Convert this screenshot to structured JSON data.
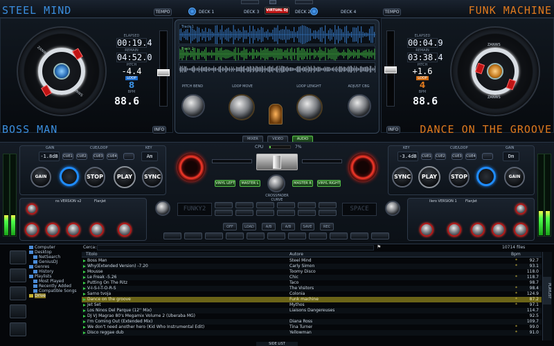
{
  "top": {
    "tempo_left": "TEMPO",
    "tempo_right": "TEMPO",
    "deck1": "DECK 1",
    "deck2": "DECK 2",
    "deck3": "DECK 3",
    "deck4": "DECK 4",
    "logo": "VIRTUAL DJ"
  },
  "left_deck": {
    "artist": "STEEL MIND",
    "title": "BOSS MAN",
    "elapsed_label": "ELAPSED",
    "elapsed": "00:19.4",
    "remain_label": "REMAIN",
    "remain": "04:52.0",
    "pitch_label": "PITCH",
    "pitch": "-4.4",
    "loop_label": "LOOP",
    "loop": "8",
    "bpm_label": "BPM",
    "bpm": "88.6",
    "info": "INFO",
    "brand": "ZANWS"
  },
  "right_deck": {
    "artist": "FUNK MACHINE",
    "title": "DANCE ON THE GROOVE",
    "elapsed_label": "ELAPSED",
    "elapsed": "00:04.9",
    "remain_label": "REMAIN",
    "remain": "03:38.4",
    "pitch_label": "PITCH",
    "pitch": "+1.6",
    "loop_label": "LOOP",
    "loop": "4",
    "bpm_label": "BPM",
    "bpm": "88.6",
    "info": "INFO",
    "brand": "ZANWS"
  },
  "center": {
    "track1_label": "Track 1",
    "track2_label": "Track 2",
    "knobs": [
      "PITCH BEND",
      "LOOP MOVE",
      "LOOP LENGHT",
      "ADJUST CBG"
    ],
    "tabs": [
      "MIXER",
      "VIDEO",
      "AUDIO"
    ]
  },
  "mixer": {
    "gain_label": "GAIN",
    "cue_label": "CUE/LOOP",
    "key_label": "KEY",
    "cpu_label": "CPU",
    "cpu_value": "7%",
    "left_gain": "-1.8dB",
    "right_gain": "-3.4dB",
    "left_key": "Am",
    "right_key": "Dm",
    "cues": [
      "CUE1",
      "CUE2",
      "CUE3",
      "CUE4"
    ],
    "stop": "STOP",
    "play": "PLAY",
    "sync": "SYNC",
    "gain_btn": "GAIN",
    "vinyl_left": "VINYL LEFT",
    "master_l": "MASTER L",
    "master_r": "MASTER R",
    "vinyl_right": "VINYL RIGHT",
    "crossfader": "CROSSFADER CURVE",
    "fx_left": "ns VERSION v2",
    "fx_left2": "FlanJet",
    "fx_right": "Ilero VERSION 1",
    "fx_right2": "FlanJet",
    "sampler_left": "FUNKY2",
    "sampler_right": "SPACE",
    "sampler_keys": [
      "OFF",
      "LOAD",
      "A/B",
      "A/B",
      "SAVE",
      "REC"
    ]
  },
  "browser": {
    "search_label": "Cerca:",
    "files_count": "10714 files",
    "col_title": "Titolo",
    "col_artist": "Autore",
    "col_bpm": "Bpm",
    "side_list": "SIDE LIST",
    "tree": [
      "Computer",
      "Desktop",
      "NetSearch",
      "GeniusDJ",
      "Genres",
      "History",
      "Playlists",
      "Most Played",
      "Recently Added",
      "Compatible Songs",
      "Drive"
    ],
    "tracks": [
      {
        "title": "Boss Man",
        "artist": "Steel Mind",
        "bpm": "92.7",
        "star": "*"
      },
      {
        "title": "Why(Extended Version) -7.20",
        "artist": "Carly Simon",
        "bpm": "93.1",
        "star": "*"
      },
      {
        "title": "Mousse",
        "artist": "Toomy Disco",
        "bpm": "118.0",
        "star": ""
      },
      {
        "title": "Le Freak -5.26",
        "artist": "Chic",
        "bpm": "118.7",
        "star": "*"
      },
      {
        "title": "Putting On The Ritz",
        "artist": "Taco",
        "bpm": "98.7",
        "star": ""
      },
      {
        "title": "V-I-S-I-T-O-R-S",
        "artist": "The Visitors",
        "bpm": "98.4",
        "star": "*"
      },
      {
        "title": "Sarno tvoja",
        "artist": "Colonia",
        "bpm": "124.9",
        "star": "*"
      },
      {
        "title": "Dance on the groove",
        "artist": "Funk machine",
        "bpm": "87.2",
        "star": "*"
      },
      {
        "title": "Jet Set",
        "artist": "Mythos",
        "bpm": "97.1",
        "star": "*"
      },
      {
        "title": "Los Ninos Del Parque (12'' Mix)",
        "artist": "Liaisons Dangereuses",
        "bpm": "114.7",
        "star": ""
      },
      {
        "title": "DJ VJ Magrao 80's Megamix Volume 2 (Uberaba MG)",
        "artist": "",
        "bpm": "92.5",
        "star": ""
      },
      {
        "title": "I'm Coming Out (Extended Mix)",
        "artist": "Diana Ross",
        "bpm": "109.7",
        "star": ""
      },
      {
        "title": "We don't need another hero (Kid Who Instrumental Edit)",
        "artist": "Tina Turner",
        "bpm": "99.0",
        "star": "*"
      },
      {
        "title": "Disco reggae dub",
        "artist": "Yellowman",
        "bpm": "91.0",
        "star": "*"
      }
    ],
    "selected_index": 7
  },
  "meters": {
    "left_vu": 0.25,
    "right_vu": 0.3,
    "crossfader": 0.5
  },
  "colors": {
    "left_accent": "#3b8fe0",
    "right_accent": "#e07a1e",
    "selected_row": "#6b6418",
    "play_green": "#3ad04a"
  }
}
